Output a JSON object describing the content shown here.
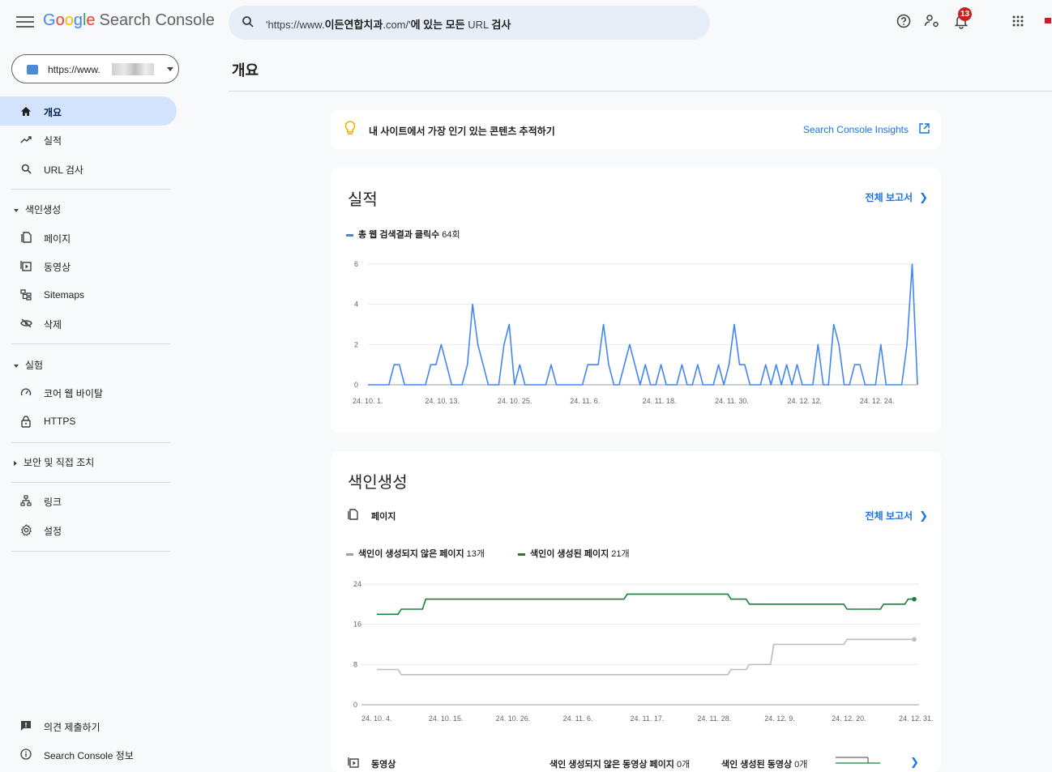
{
  "app": {
    "logo_letters": [
      "G",
      "o",
      "o",
      "g",
      "l",
      "e"
    ],
    "product": "Search Console"
  },
  "search": {
    "prefix": "'https://www.",
    "bold_domain": "이든연합치과",
    "mid": ".com/'",
    "suffix_bold": "에 있는 모든",
    "suffix": " URL ",
    "suffix_bold2": "검사"
  },
  "topbar": {
    "notification_count": "13",
    "icons": [
      "help-icon",
      "manage-accounts-icon",
      "notifications-icon",
      "apps-icon",
      "account-icon"
    ]
  },
  "property": {
    "label": "https://www."
  },
  "sidebar": {
    "items_top": [
      {
        "label": "개요",
        "icon": "home-icon",
        "active": true
      },
      {
        "label": "실적",
        "icon": "trending-up-icon"
      },
      {
        "label": "URL 검사",
        "icon": "search-icon"
      }
    ],
    "section_indexing": "색인생성",
    "items_indexing": [
      {
        "label": "페이지",
        "icon": "pages-icon"
      },
      {
        "label": "동영상",
        "icon": "video-pages-icon"
      },
      {
        "label": "Sitemaps",
        "icon": "sitemap-icon"
      },
      {
        "label": "삭제",
        "icon": "removals-icon"
      }
    ],
    "section_experience": "실험",
    "items_experience": [
      {
        "label": "코어 웹 바이탈",
        "icon": "speed-icon"
      },
      {
        "label": "HTTPS",
        "icon": "lock-icon"
      }
    ],
    "section_security": "보안 및 직접 조치",
    "items_bottom": [
      {
        "label": "링크",
        "icon": "links-icon"
      },
      {
        "label": "설정",
        "icon": "settings-icon"
      }
    ],
    "feedback": "의견 제출하기",
    "about": "Search Console 정보"
  },
  "main": {
    "title": "개요",
    "insights": {
      "text": "내 사이트에서 가장 인기 있는 콘텐츠 추적하기",
      "link": "Search Console Insights"
    },
    "performance": {
      "title": "실적",
      "full_report": "전체 보고서",
      "legend_label": "총 웹 검색결과 클릭수",
      "legend_count": " 64회"
    },
    "indexing": {
      "title": "색인생성",
      "pages_label": "페이지",
      "full_report": "전체 보고서",
      "legend_not_indexed": "색인이 생성되지 않은 페이지",
      "legend_not_indexed_count": " 13개",
      "legend_indexed": "색인이 생성된 페이지",
      "legend_indexed_count": " 21개",
      "video_label": "동영상",
      "video_not_indexed": "색인 생성되지 않은 동영상 페이지",
      "video_not_indexed_count": " 0개",
      "video_indexed": "색인 생성된 동영상",
      "video_indexed_count": " 0개"
    }
  },
  "colors": {
    "clicks": "#4285f4",
    "indexed": "#188038",
    "not_indexed": "#bdbdbd",
    "link": "#1a73e8",
    "active_nav": "#d3e3fd"
  },
  "chart_data": [
    {
      "type": "line",
      "title": "실적",
      "series": [
        {
          "name": "총 웹 검색결과 클릭수",
          "values": [
            0,
            0,
            0,
            0,
            0,
            1,
            1,
            0,
            0,
            0,
            0,
            0,
            1,
            1,
            2,
            1,
            0,
            0,
            0,
            1,
            4,
            2,
            1,
            0,
            0,
            0,
            2,
            3,
            0,
            1,
            0,
            0,
            0,
            0,
            0,
            1,
            0,
            0,
            0,
            0,
            0,
            0,
            1,
            1,
            1,
            3,
            1,
            0,
            0,
            1,
            2,
            1,
            0,
            1,
            0,
            0,
            1,
            0,
            0,
            0,
            1,
            0,
            0,
            1,
            0,
            0,
            0,
            1,
            0,
            1,
            3,
            1,
            1,
            0,
            0,
            0,
            1,
            0,
            1,
            0,
            1,
            0,
            1,
            0,
            0,
            0,
            2,
            0,
            0,
            3,
            2,
            0,
            0,
            1,
            1,
            0,
            0,
            0,
            2,
            0,
            0,
            0,
            0,
            2,
            6,
            0
          ]
        }
      ],
      "x_start": "24. 10. 1.",
      "x_end": "24. 12. 31.",
      "x_ticks": [
        "24. 10. 1.",
        "24. 10. 13.",
        "24. 10. 25.",
        "24. 11. 6.",
        "24. 11. 18.",
        "24. 11. 30.",
        "24. 12. 12.",
        "24. 12. 24."
      ],
      "y_ticks": [
        0,
        2,
        4,
        6
      ],
      "ylim": [
        0,
        6
      ],
      "grid": true
    },
    {
      "type": "line",
      "title": "색인생성",
      "series": [
        {
          "name": "색인이 생성된 페이지",
          "steps": [
            {
              "date": "24. 10. 4.",
              "value": 18
            },
            {
              "date": "24. 10. 8.",
              "value": 19
            },
            {
              "date": "24. 10. 12.",
              "value": 21
            },
            {
              "date": "24. 11. 14.",
              "value": 22
            },
            {
              "date": "24. 12. 1.",
              "value": 21
            },
            {
              "date": "24. 12. 4.",
              "value": 20
            },
            {
              "date": "24. 12. 20.",
              "value": 19
            },
            {
              "date": "24. 12. 26.",
              "value": 20
            },
            {
              "date": "24. 12. 30.",
              "value": 21
            },
            {
              "date": "24. 12. 31.",
              "value": 21
            }
          ]
        },
        {
          "name": "색인이 생성되지 않은 페이지",
          "steps": [
            {
              "date": "24. 10. 4.",
              "value": 7
            },
            {
              "date": "24. 10. 8.",
              "value": 6
            },
            {
              "date": "24. 12. 1.",
              "value": 7
            },
            {
              "date": "24. 12. 4.",
              "value": 8
            },
            {
              "date": "24. 12. 8.",
              "value": 12
            },
            {
              "date": "24. 12. 20.",
              "value": 13
            },
            {
              "date": "24. 12. 31.",
              "value": 13
            }
          ]
        }
      ],
      "x_start": "24. 10. 4.",
      "x_end": "24. 12. 31.",
      "x_ticks": [
        "24. 10. 4.",
        "24. 10. 15.",
        "24. 10. 26.",
        "24. 11. 6.",
        "24. 11. 17.",
        "24. 11. 28.",
        "24. 12. 9.",
        "24. 12. 20.",
        "24. 12. 31."
      ],
      "y_ticks": [
        0,
        8,
        16,
        24
      ],
      "ylim": [
        0,
        24
      ],
      "grid": true
    }
  ]
}
